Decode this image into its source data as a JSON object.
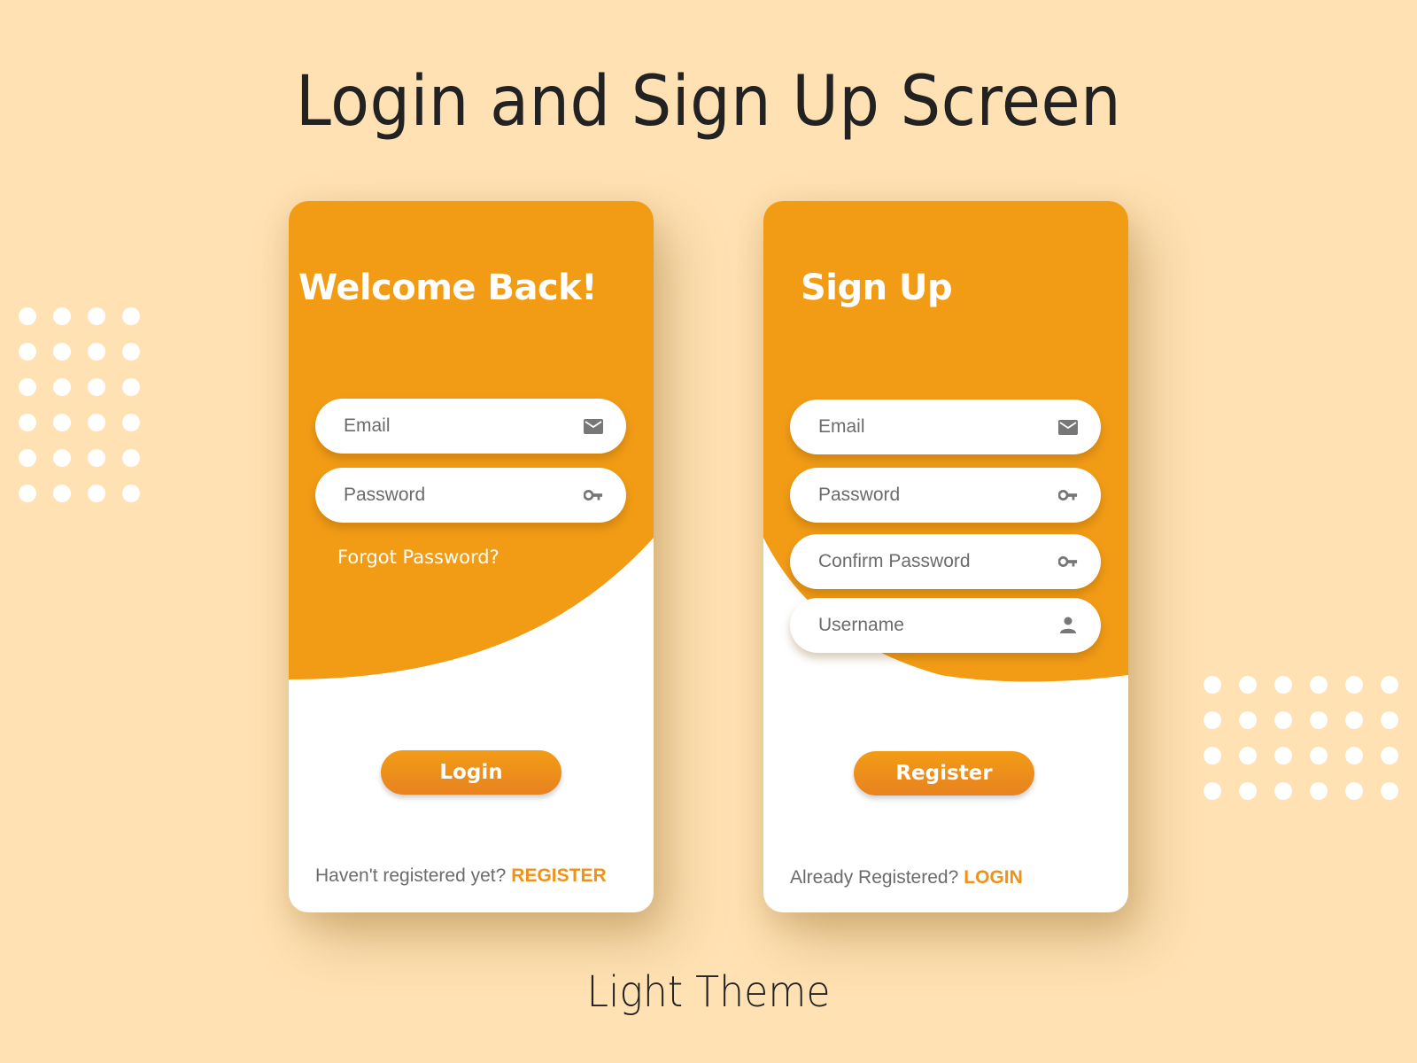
{
  "page": {
    "title": "Login and Sign Up Screen",
    "subtitle": "Light Theme"
  },
  "colors": {
    "background": "#FFE1B3",
    "accent": "#F29C16",
    "accent_dark": "#E8821F",
    "field_text": "#6b6b6b",
    "link": "#EF9217"
  },
  "login": {
    "heading": "Welcome Back!",
    "fields": [
      {
        "placeholder": "Email",
        "icon": "mail-icon",
        "value": ""
      },
      {
        "placeholder": "Password",
        "icon": "key-icon",
        "value": ""
      }
    ],
    "forgot_label": "Forgot Password?",
    "button_label": "Login",
    "footer_text": "Haven't registered yet?",
    "footer_link": "REGISTER"
  },
  "signup": {
    "heading": "Sign Up",
    "fields": [
      {
        "placeholder": "Email",
        "icon": "mail-icon",
        "value": ""
      },
      {
        "placeholder": "Password",
        "icon": "key-icon",
        "value": ""
      },
      {
        "placeholder": "Confirm Password",
        "icon": "key-icon",
        "value": ""
      },
      {
        "placeholder": "Username",
        "icon": "person-icon",
        "value": ""
      }
    ],
    "button_label": "Register",
    "footer_text": "Already Registered?",
    "footer_link": "LOGIN"
  }
}
